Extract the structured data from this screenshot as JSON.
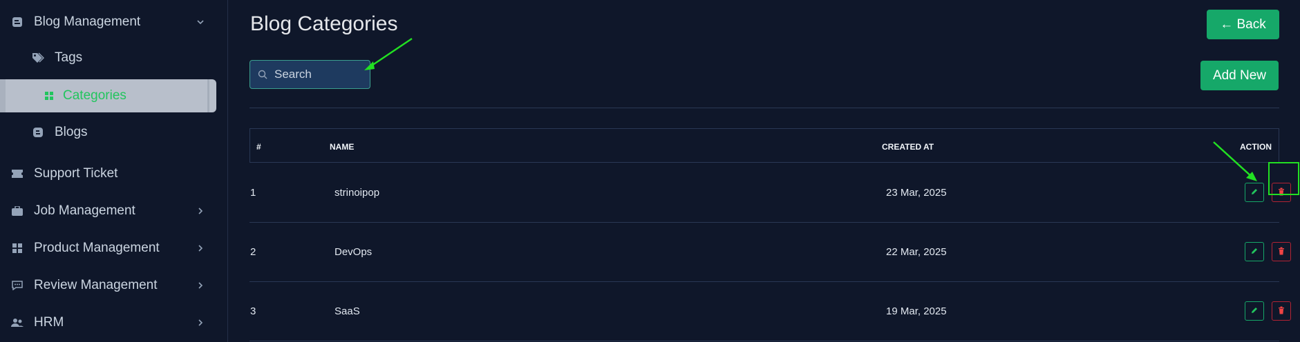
{
  "sidebar": {
    "items": [
      {
        "label": "Blog Management",
        "icon": "blog-icon",
        "chevron": "chevron-down-icon"
      },
      {
        "label": "Tags",
        "icon": "tags-icon"
      },
      {
        "label": "Categories",
        "icon": "grid-icon",
        "active": true
      },
      {
        "label": "Blogs",
        "icon": "blog-icon"
      },
      {
        "label": "Support Ticket",
        "icon": "ticket-icon"
      },
      {
        "label": "Job Management",
        "icon": "briefcase-icon",
        "chevron": "chevron-right-icon"
      },
      {
        "label": "Product Management",
        "icon": "grid-icon",
        "chevron": "chevron-right-icon"
      },
      {
        "label": "Review Management",
        "icon": "comment-icon",
        "chevron": "chevron-right-icon"
      },
      {
        "label": "HRM",
        "icon": "users-icon",
        "chevron": "chevron-right-icon"
      }
    ]
  },
  "header": {
    "title": "Blog Categories",
    "back_label": "← Back",
    "add_label": "Add New"
  },
  "search": {
    "placeholder": "Search"
  },
  "table": {
    "columns": [
      "#",
      "NAME",
      "CREATED AT",
      "ACTION"
    ],
    "rows": [
      {
        "num": "1",
        "name": "strinoipop",
        "created": "23 Mar, 2025"
      },
      {
        "num": "2",
        "name": "DevOps",
        "created": "22 Mar, 2025"
      },
      {
        "num": "3",
        "name": "SaaS",
        "created": "19 Mar, 2025"
      }
    ]
  },
  "colors": {
    "background": "#0f172a",
    "accent_green": "#16a869",
    "active_text": "#22c55e",
    "delete_red": "#b42334",
    "annotation": "#22e022"
  }
}
